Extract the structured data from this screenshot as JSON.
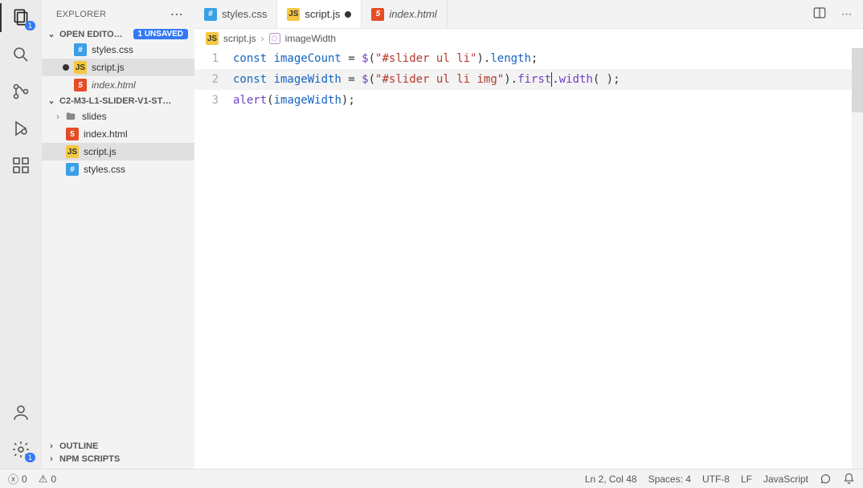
{
  "sidebar": {
    "title": "EXPLORER",
    "open_editors_label": "OPEN EDITO…",
    "unsaved_badge": "1 UNSAVED",
    "open_editors": [
      {
        "name": "styles.css",
        "kind": "css",
        "unsaved": false,
        "italic": false
      },
      {
        "name": "script.js",
        "kind": "js",
        "unsaved": true,
        "italic": false,
        "selected": true
      },
      {
        "name": "index.html",
        "kind": "html",
        "unsaved": false,
        "italic": true
      }
    ],
    "project_label": "C2-M3-L1-SLIDER-V1-ST…",
    "tree": {
      "folder": "slides",
      "files": [
        {
          "name": "index.html",
          "kind": "html"
        },
        {
          "name": "script.js",
          "kind": "js",
          "selected": true
        },
        {
          "name": "styles.css",
          "kind": "css"
        }
      ]
    },
    "outline_label": "OUTLINE",
    "npm_label": "NPM SCRIPTS"
  },
  "activity": {
    "files_badge": "1",
    "gear_badge": "1"
  },
  "tabs": [
    {
      "name": "styles.css",
      "kind": "css",
      "active": false,
      "unsaved": false
    },
    {
      "name": "script.js",
      "kind": "js",
      "active": true,
      "unsaved": true
    },
    {
      "name": "index.html",
      "kind": "html",
      "active": false,
      "unsaved": false,
      "italic": true
    }
  ],
  "breadcrumb": {
    "file": "script.js",
    "symbol": "imageWidth"
  },
  "code": {
    "lines": [
      {
        "n": "1",
        "tokens": [
          {
            "t": "const ",
            "c": "tok-kw"
          },
          {
            "t": "imageCount",
            "c": "tok-var"
          },
          {
            "t": " = ",
            "c": ""
          },
          {
            "t": "$",
            "c": "tok-fn"
          },
          {
            "t": "(",
            "c": ""
          },
          {
            "t": "\"#slider ul li\"",
            "c": "tok-str"
          },
          {
            "t": ").",
            "c": ""
          },
          {
            "t": "length",
            "c": "tok-var"
          },
          {
            "t": ";",
            "c": ""
          }
        ]
      },
      {
        "n": "2",
        "current": true,
        "tokens": [
          {
            "t": "const ",
            "c": "tok-kw"
          },
          {
            "t": "imageWidth",
            "c": "tok-var"
          },
          {
            "t": " = ",
            "c": ""
          },
          {
            "t": "$",
            "c": "tok-fn"
          },
          {
            "t": "(",
            "c": ""
          },
          {
            "t": "\"#slider ul li img\"",
            "c": "tok-str"
          },
          {
            "t": ").",
            "c": ""
          },
          {
            "t": "first",
            "c": "tok-fn"
          },
          {
            "caret": true
          },
          {
            "t": ".",
            "c": ""
          },
          {
            "t": "width",
            "c": "tok-fn"
          },
          {
            "t": "( );",
            "c": ""
          }
        ]
      },
      {
        "n": "3",
        "tokens": [
          {
            "t": "alert",
            "c": "tok-fn"
          },
          {
            "t": "(",
            "c": ""
          },
          {
            "t": "imageWidth",
            "c": "tok-var"
          },
          {
            "t": ");",
            "c": ""
          }
        ]
      }
    ]
  },
  "status": {
    "errors": "0",
    "warnings": "0",
    "cursor": "Ln 2, Col 48",
    "spaces": "Spaces: 4",
    "encoding": "UTF-8",
    "eol": "LF",
    "language": "JavaScript"
  }
}
